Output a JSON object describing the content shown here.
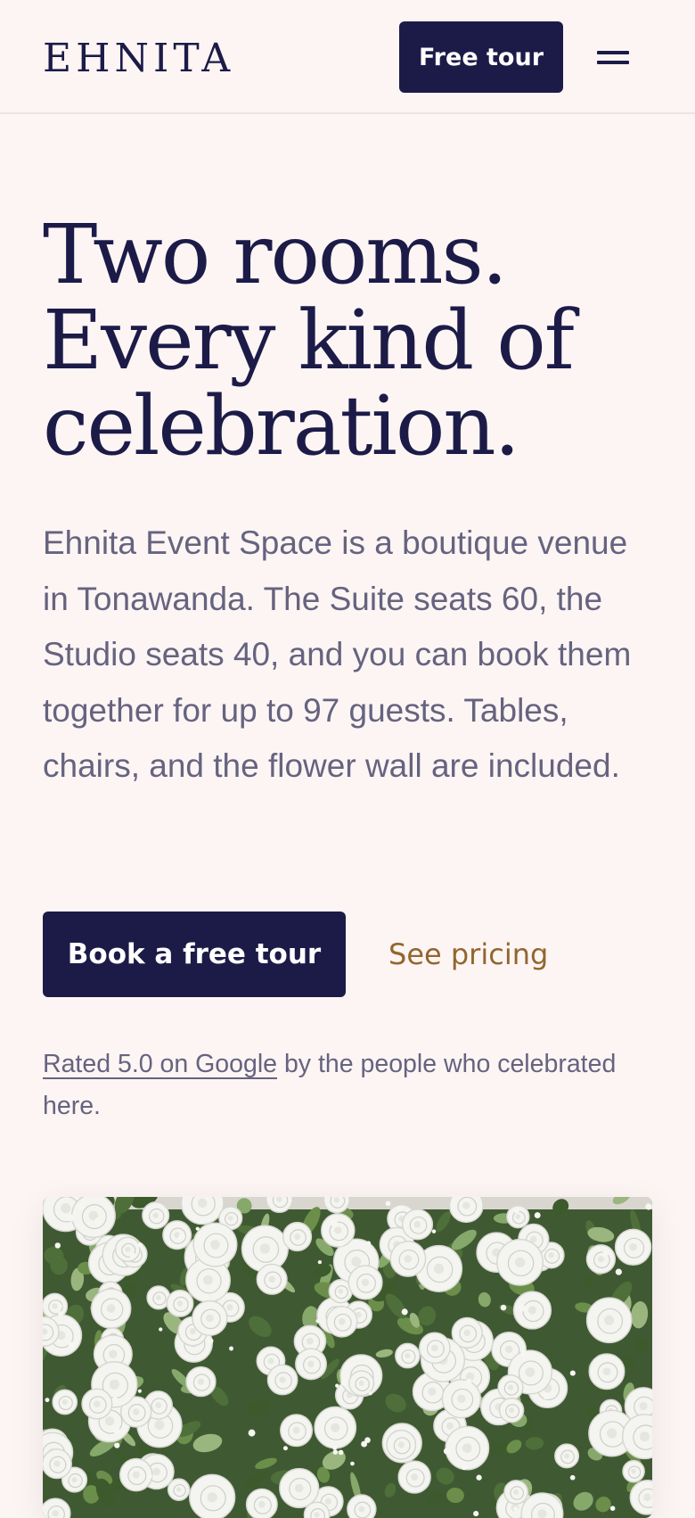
{
  "header": {
    "logo": "EHNITA",
    "tour_button": "Free tour",
    "menu_icon": "hamburger-menu-icon"
  },
  "hero": {
    "title_lines": [
      "Two rooms.",
      "Every kind of",
      "celebration."
    ],
    "description": "Ehnita Event Space is a boutique venue in Tonawanda. The Suite seats 60, the Studio seats 40, and you can book them together for up to 97 guests. Tables, chairs, and the flower wall are included.",
    "primary_button": "Book a free tour",
    "secondary_link": "See pricing",
    "rating_link": "Rated 5.0 on Google",
    "rating_suffix": " by the people who celebrated here."
  },
  "colors": {
    "background": "#fcf5f4",
    "navy": "#1c1b48",
    "muted_text": "#66637f",
    "accent_gold": "#93662e"
  }
}
